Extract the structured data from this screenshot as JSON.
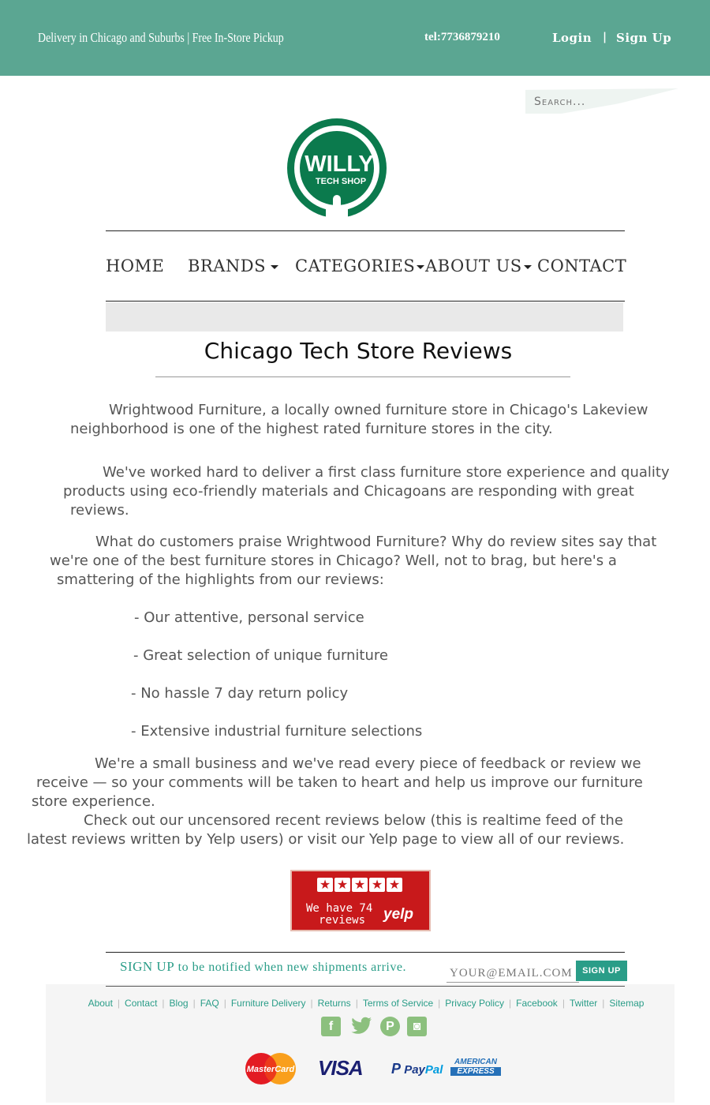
{
  "topbar": {
    "tagline": "Delivery in Chicago and Suburbs | Free In-Store Pickup",
    "phone": "tel:7736879210",
    "login": "Login",
    "separator": "|",
    "signup": "Sign Up",
    "background": "#5ba692"
  },
  "search": {
    "placeholder": "Search..."
  },
  "logo": {
    "line1": "WILLY",
    "line2": "TECH SHOP",
    "color": "#0b7a4d"
  },
  "nav": {
    "items": [
      {
        "label": "HOME"
      },
      {
        "label": "BRANDS"
      },
      {
        "label": "CATEGORIES"
      },
      {
        "label": "ABOUT US"
      },
      {
        "label": "CONTACT"
      }
    ]
  },
  "main": {
    "title": "Chicago Tech Store Reviews",
    "p1": [
      "Wrightwood Furniture, a locally owned furniture store in Chicago's Lakeview",
      "neighborhood is one of the highest rated furniture stores in the city."
    ],
    "p2": [
      "We've worked hard to deliver a first class furniture store experience and quality",
      "products using eco-friendly materials and Chicagoans are responding with great",
      "reviews."
    ],
    "p3": [
      "What do customers praise Wrightwood Furniture? Why do review sites say that",
      "we're one of the best furniture stores in Chicago? Well, not to brag, but here's a",
      "smattering of the highlights from our reviews:"
    ],
    "bullets": [
      "- Our attentive, personal service",
      "- Great selection of unique furniture",
      "-  No hassle 7 day return policy",
      "-  Extensive industrial furniture selections"
    ],
    "p4": [
      "We're a small business and we've read every piece of feedback or review we",
      "receive — so your comments will be taken to heart and help us improve our furniture",
      "store experience."
    ],
    "p5": [
      "Check out our uncensored recent reviews below (this is realtime feed of the",
      "latest reviews written by Yelp users) or visit our Yelp page to view all of our reviews."
    ]
  },
  "yelp": {
    "stars": [
      "★",
      "★",
      "★",
      "★",
      "★"
    ],
    "count_line1": "We have 74",
    "count_line2": "reviews",
    "brand": "yelp",
    "color": "#c8191b"
  },
  "newsletter": {
    "lead": "SIGN UP",
    "text": " to be notified when new shipments arrive.",
    "email_placeholder": "YOUR@EMAIL.COM",
    "button": "SIGN UP",
    "accent": "#2a9d88"
  },
  "footer": {
    "links": [
      "About",
      "Contact",
      "Blog",
      "FAQ",
      "Furniture Delivery",
      "Returns",
      "Terms of Service",
      "Privacy Policy",
      "Facebook",
      "Twitter",
      "Sitemap"
    ],
    "social": [
      {
        "icon": "facebook-icon",
        "glyph": "f"
      },
      {
        "icon": "twitter-icon",
        "glyph": "🐦"
      },
      {
        "icon": "pinterest-icon",
        "glyph": "P"
      },
      {
        "icon": "instagram-icon",
        "glyph": "◙"
      }
    ],
    "payments": {
      "mastercard": "MasterCard",
      "visa": "VISA",
      "paypal_a": "Pay",
      "paypal_b": "Pal",
      "amex_1": "AMERICAN",
      "amex_2": "EXPRESS"
    }
  }
}
